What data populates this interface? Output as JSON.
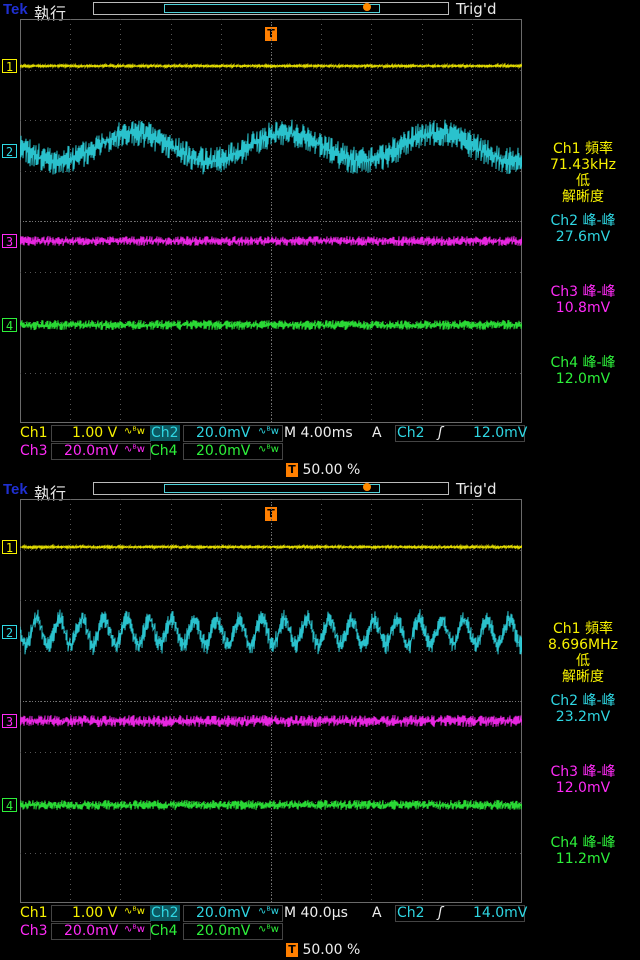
{
  "colors": {
    "ch1": "#f7f100",
    "ch2": "#2fd7e3",
    "ch3": "#ff2bf7",
    "ch4": "#2df03a",
    "trigger": "#ff7f00",
    "brand": "#1f2fd0"
  },
  "panels": [
    {
      "brand": "Tek",
      "mode": "執行",
      "trig_state": "Trig'd",
      "markers": {
        "ch1": "1",
        "ch2": "2",
        "ch3": "3",
        "ch4": "4",
        "trigger": "T"
      },
      "side": {
        "ch1_title": "Ch1 頻率",
        "ch1_value": "71.43kHz",
        "ch1_note1": "低",
        "ch1_note2": "解晰度",
        "ch2_title": "Ch2 峰-峰",
        "ch2_value": "27.6mV",
        "ch3_title": "Ch3 峰-峰",
        "ch3_value": "10.8mV",
        "ch4_title": "Ch4 峰-峰",
        "ch4_value": "12.0mV"
      },
      "status": {
        "ch1_label": "Ch1",
        "ch1_scale": "1.00 V",
        "ch2_label": "Ch2",
        "ch2_scale": "20.0mV",
        "ch3_label": "Ch3",
        "ch3_scale": "20.0mV",
        "ch4_label": "Ch4",
        "ch4_scale": "20.0mV",
        "bw_icon": "∿ᴮw",
        "timebase": "M 4.00ms",
        "trig_source_prefix": "A",
        "trig_source": "Ch2",
        "trig_slope_icon": "rising-edge-icon",
        "trig_slope_glyph": "ʃ",
        "trig_level": "12.0mV",
        "trig_pos_label": "T",
        "trig_pos": "50.00 %"
      }
    },
    {
      "brand": "Tek",
      "mode": "執行",
      "trig_state": "Trig'd",
      "markers": {
        "ch1": "1",
        "ch2": "2",
        "ch3": "3",
        "ch4": "4",
        "trigger": "T"
      },
      "side": {
        "ch1_title": "Ch1 頻率",
        "ch1_value": "8.696MHz",
        "ch1_note1": "低",
        "ch1_note2": "解晰度",
        "ch2_title": "Ch2 峰-峰",
        "ch2_value": "23.2mV",
        "ch3_title": "Ch3 峰-峰",
        "ch3_value": "12.0mV",
        "ch4_title": "Ch4 峰-峰",
        "ch4_value": "11.2mV"
      },
      "status": {
        "ch1_label": "Ch1",
        "ch1_scale": "1.00 V",
        "ch2_label": "Ch2",
        "ch2_scale": "20.0mV",
        "ch3_label": "Ch3",
        "ch3_scale": "20.0mV",
        "ch4_label": "Ch4",
        "ch4_scale": "20.0mV",
        "bw_icon": "∿ᴮw",
        "timebase": "M 40.0µs",
        "trig_source_prefix": "A",
        "trig_source": "Ch2",
        "trig_slope_icon": "rising-edge-icon",
        "trig_slope_glyph": "ʃ",
        "trig_level": "14.0mV",
        "trig_pos_label": "T",
        "trig_pos": "50.00 %"
      }
    }
  ]
}
